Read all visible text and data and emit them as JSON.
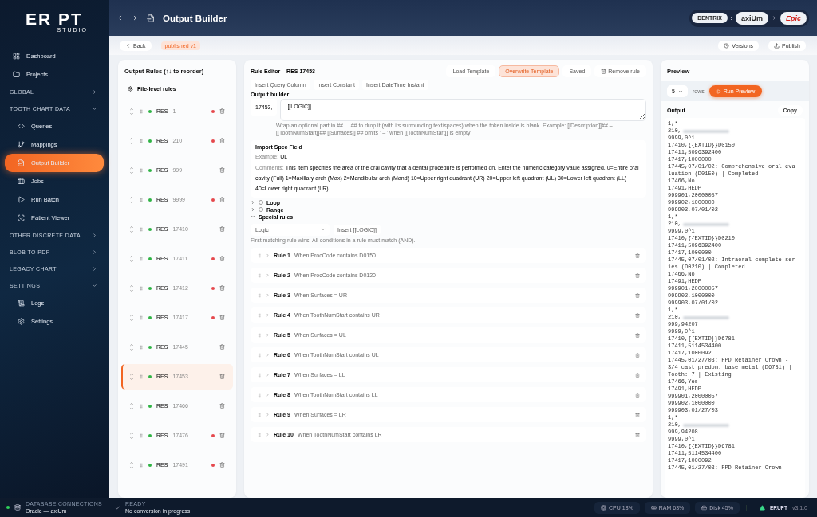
{
  "brand": {
    "name": "ER PT",
    "sub": "STUDIO"
  },
  "nav": [
    {
      "kind": "item",
      "label": "Dashboard",
      "selected": false
    },
    {
      "kind": "item",
      "label": "Projects",
      "selected": false
    },
    {
      "kind": "section",
      "label": "GLOBAL",
      "expanded": false
    },
    {
      "kind": "section",
      "label": "TOOTH CHART DATA",
      "expanded": true,
      "children": [
        {
          "label": "Queries",
          "selected": false
        },
        {
          "label": "Mappings",
          "selected": false
        },
        {
          "label": "Output Builder",
          "selected": true
        },
        {
          "label": "Jobs",
          "selected": false
        },
        {
          "label": "Run Batch",
          "selected": false
        },
        {
          "label": "Patient Viewer",
          "selected": false
        }
      ]
    },
    {
      "kind": "section",
      "label": "OTHER DISCRETE DATA",
      "expanded": false
    },
    {
      "kind": "section",
      "label": "BLOB TO PDF",
      "expanded": false
    },
    {
      "kind": "section",
      "label": "LEGACY CHART",
      "expanded": false
    },
    {
      "kind": "section",
      "label": "SETTINGS",
      "expanded": true,
      "children": [
        {
          "label": "Logs",
          "selected": false
        },
        {
          "label": "Settings",
          "selected": false
        }
      ]
    }
  ],
  "header": {
    "title": "Output Builder",
    "sources": [
      "DENTRIX",
      "axiUm"
    ],
    "target": "Epic"
  },
  "subbar": {
    "back": "Back",
    "tag": "published v1",
    "versions": "Versions",
    "publish": "Publish"
  },
  "rules_panel": {
    "title": "Output Rules (↑↓ to reorder)",
    "file_level": "File-level rules",
    "rows": [
      {
        "prefix": "RES",
        "code": "1",
        "modified": true,
        "selected": false
      },
      {
        "prefix": "RES",
        "code": "210",
        "modified": true,
        "selected": false
      },
      {
        "prefix": "RES",
        "code": "999",
        "modified": false,
        "selected": false
      },
      {
        "prefix": "RES",
        "code": "9999",
        "modified": true,
        "selected": false
      },
      {
        "prefix": "RES",
        "code": "17410",
        "modified": false,
        "selected": false
      },
      {
        "prefix": "RES",
        "code": "17411",
        "modified": true,
        "selected": false
      },
      {
        "prefix": "RES",
        "code": "17412",
        "modified": true,
        "selected": false
      },
      {
        "prefix": "RES",
        "code": "17417",
        "modified": true,
        "selected": false
      },
      {
        "prefix": "RES",
        "code": "17445",
        "modified": false,
        "selected": false
      },
      {
        "prefix": "RES",
        "code": "17453",
        "modified": false,
        "selected": true
      },
      {
        "prefix": "RES",
        "code": "17466",
        "modified": false,
        "selected": false
      },
      {
        "prefix": "RES",
        "code": "17476",
        "modified": true,
        "selected": false
      },
      {
        "prefix": "RES",
        "code": "17491",
        "modified": true,
        "selected": false
      }
    ]
  },
  "editor": {
    "title": "Rule Editor – RES 17453",
    "actions": [
      {
        "label": "Load Template",
        "selected": false
      },
      {
        "label": "Overwrite Template",
        "selected": true
      },
      {
        "label": "Saved",
        "selected": false
      }
    ],
    "remove": "Remove rule",
    "inserts": [
      "Insert Query Column",
      "Insert Constant",
      "Insert DateTime Instant"
    ],
    "builder_label": "Output builder",
    "prefix": "17453,",
    "template": "[[LOGIC]]",
    "hint": "Wrap an optional part in ## ... ## to drop it (with its surrounding text/spaces) when the token inside is blank. Example: [[Description]]## – [[ToothNumStart]]## [[Surfaces]] ## omits ' – ' when [[ToothNumStart]] is empty",
    "spec": {
      "title": "Import Spec Field",
      "example_label": "Example:",
      "example": "UL",
      "comments_label": "Comments:",
      "comments": "This item specifies the area of the oral cavity that a dental procedure is performed on. Enter the numeric category value assigned. 0=Entire oral cavity (Full) 1=Maxillary arch (Max) 2=Mandibular arch (Mand) 10=Upper right quadrant (UR) 20=Upper left quadrant (UL) 30=Lower left quadrant (LL) 40=Lower right quadrant (LR)"
    },
    "options": [
      {
        "label": "Loop",
        "checked": false,
        "expanded": false
      },
      {
        "label": "Range",
        "checked": false,
        "expanded": false
      }
    ],
    "special": {
      "label": "Special rules",
      "expanded": true
    },
    "select": "Logic",
    "insert_logic": "Insert [[LOGIC]]",
    "match_hint": "First matching rule wins. All conditions in a rule must match (AND).",
    "rules": [
      {
        "name": "Rule 1",
        "condition": "When ProcCode contains D0150"
      },
      {
        "name": "Rule 2",
        "condition": "When ProcCode contains D0120"
      },
      {
        "name": "Rule 3",
        "condition": "When Surfaces = UR"
      },
      {
        "name": "Rule 4",
        "condition": "When ToothNumStart contains UR"
      },
      {
        "name": "Rule 5",
        "condition": "When Surfaces = UL"
      },
      {
        "name": "Rule 6",
        "condition": "When ToothNumStart contains UL"
      },
      {
        "name": "Rule 7",
        "condition": "When Surfaces = LL"
      },
      {
        "name": "Rule 8",
        "condition": "When ToothNumStart contains LL"
      },
      {
        "name": "Rule 9",
        "condition": "When Surfaces = LR"
      },
      {
        "name": "Rule 10",
        "condition": "When ToothNumStart contains LR"
      }
    ]
  },
  "preview": {
    "title": "Preview",
    "rows": "5",
    "rows_label": "rows",
    "run": "Run Preview",
    "output_label": "Output",
    "copy": "Copy",
    "lines": [
      {
        "text": "1,*",
        "redacted": false
      },
      {
        "text": "210,",
        "redacted": true
      },
      {
        "text": "9999,0^1",
        "redacted": false
      },
      {
        "text": "17410,{{EXTID}}D0150",
        "redacted": false
      },
      {
        "text": "17411,5096392400",
        "redacted": false
      },
      {
        "text": "17417,1000000",
        "redacted": false
      },
      {
        "text": "17445,07/01/02: Comprehensive oral eva",
        "redacted": false
      },
      {
        "text": "luation (D0150) | Completed",
        "redacted": false
      },
      {
        "text": "17466,No",
        "redacted": false
      },
      {
        "text": "17491,HEDP",
        "redacted": false
      },
      {
        "text": "999901,20000057",
        "redacted": false
      },
      {
        "text": "999902,1000000",
        "redacted": false
      },
      {
        "text": "999903,07/01/02",
        "redacted": false
      },
      {
        "text": "1,*",
        "redacted": false
      },
      {
        "text": "210,",
        "redacted": true
      },
      {
        "text": "9999,0^1",
        "redacted": false
      },
      {
        "text": "17410,{{EXTID}}D0210",
        "redacted": false
      },
      {
        "text": "17411,5096392400",
        "redacted": false
      },
      {
        "text": "17417,1000000",
        "redacted": false
      },
      {
        "text": "17445,07/01/02: Intraoral-complete ser",
        "redacted": false
      },
      {
        "text": "ies (D0210) | Completed",
        "redacted": false
      },
      {
        "text": "17466,No",
        "redacted": false
      },
      {
        "text": "17491,HEDP",
        "redacted": false
      },
      {
        "text": "999901,20000057",
        "redacted": false
      },
      {
        "text": "999902,1000000",
        "redacted": false
      },
      {
        "text": "999903,07/01/02",
        "redacted": false
      },
      {
        "text": "1,*",
        "redacted": false
      },
      {
        "text": "210,",
        "redacted": true
      },
      {
        "text": "999,94207",
        "redacted": false
      },
      {
        "text": "9999,0^1",
        "redacted": false
      },
      {
        "text": "17410,{{EXTID}}D6781",
        "redacted": false
      },
      {
        "text": "17411,5114534400",
        "redacted": false
      },
      {
        "text": "17417,1000092",
        "redacted": false
      },
      {
        "text": "17445,01/27/03: FPD Retainer Crown -",
        "redacted": false
      },
      {
        "text": "3/4 cast predom. base metal (D6781) |",
        "redacted": false
      },
      {
        "text": "Tooth: 7 | Existing",
        "redacted": false
      },
      {
        "text": "17466,Yes",
        "redacted": false
      },
      {
        "text": "17491,HEDP",
        "redacted": false
      },
      {
        "text": "999901,20000057",
        "redacted": false
      },
      {
        "text": "999902,1000000",
        "redacted": false
      },
      {
        "text": "999903,01/27/03",
        "redacted": false
      },
      {
        "text": "1,*",
        "redacted": false
      },
      {
        "text": "210,",
        "redacted": true
      },
      {
        "text": "999,94208",
        "redacted": false
      },
      {
        "text": "9999,0^1",
        "redacted": false
      },
      {
        "text": "17410,{{EXTID}}D6781",
        "redacted": false
      },
      {
        "text": "17411,5114534400",
        "redacted": false
      },
      {
        "text": "17417,1000092",
        "redacted": false
      },
      {
        "text": "17445,01/27/03: FPD Retainer Crown -",
        "redacted": false
      }
    ]
  },
  "status": {
    "db_label": "DATABASE CONNECTIONS",
    "db_value": "Oracle — axiUm",
    "db_online": true,
    "state": "READY",
    "state_detail": "No conversion in progress",
    "meters": [
      "CPU 18%",
      "RAM 63%",
      "Disk 45%"
    ],
    "app": "ERUPT",
    "version": "v3.1.0"
  }
}
